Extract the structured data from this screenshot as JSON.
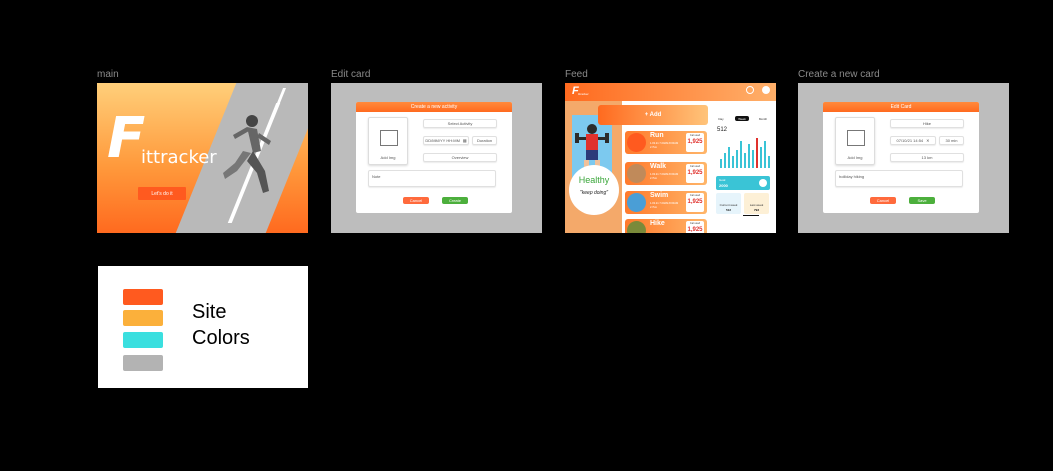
{
  "frames": {
    "main": {
      "label": "main",
      "brand_letter": "F",
      "brand_rest": "ittracker",
      "cta": "Let's do it"
    },
    "edit": {
      "label": "Edit card",
      "header": "Create a new activity",
      "image_label": "Add Img",
      "select_activity": "Select Activity",
      "date_placeholder": "DD/MM/YY HH:MM",
      "duration": "Duration",
      "overview": "Overview",
      "note": "Note",
      "cancel": "Cancel",
      "create": "Create"
    },
    "feed": {
      "label": "Feed",
      "add_button": "+ Add",
      "poster_title": "Healthy",
      "poster_sub": "\"keep doing\"",
      "activities": [
        {
          "name": "Run",
          "kcal_label": "Cal used",
          "kcal": "1,925",
          "meta1": "1.03.21  7:20AM-8:00AM",
          "meta2": "2.7km"
        },
        {
          "name": "Walk",
          "kcal_label": "Cal used",
          "kcal": "1,925",
          "meta1": "1.03.21  7:20AM-8:00AM",
          "meta2": "2.7km"
        },
        {
          "name": "Swim",
          "kcal_label": "Cal used",
          "kcal": "1,925",
          "meta1": "1.03.21  7:20AM-8:00AM",
          "meta2": "2.7km"
        },
        {
          "name": "Hike",
          "kcal_label": "Cal used",
          "kcal": "1,925",
          "meta1": "",
          "meta2": ""
        }
      ],
      "tabs": [
        "Day",
        "Week",
        "Month"
      ],
      "total": "512",
      "teal_card_title": "Goal",
      "teal_card_value": "2000",
      "mini_cards": [
        {
          "label": "Current week",
          "value": "512"
        },
        {
          "label": "Last week",
          "value": "793"
        }
      ],
      "chart_bars": [
        3,
        5,
        7,
        4,
        6,
        9,
        5,
        8,
        6,
        10,
        7,
        9,
        4
      ],
      "colors": {
        "accent": "#ff6a1f",
        "teal": "#3ac4d6",
        "red": "#e0312d"
      }
    },
    "create": {
      "label": "Create a new card",
      "header": "Edit Card",
      "image_label": "Add Img",
      "activity": "Hike",
      "date": "07/10/21 14:54",
      "duration": "30 min",
      "distance": "13 km",
      "note": "holliday hiking",
      "cancel": "Cancel",
      "save": "Save"
    }
  },
  "site_colors": {
    "title_line1": "Site",
    "title_line2": "Colors",
    "swatches": [
      "#ff5a1f",
      "#fbb03b",
      "#3adfdf",
      "#b3b3b3"
    ]
  }
}
